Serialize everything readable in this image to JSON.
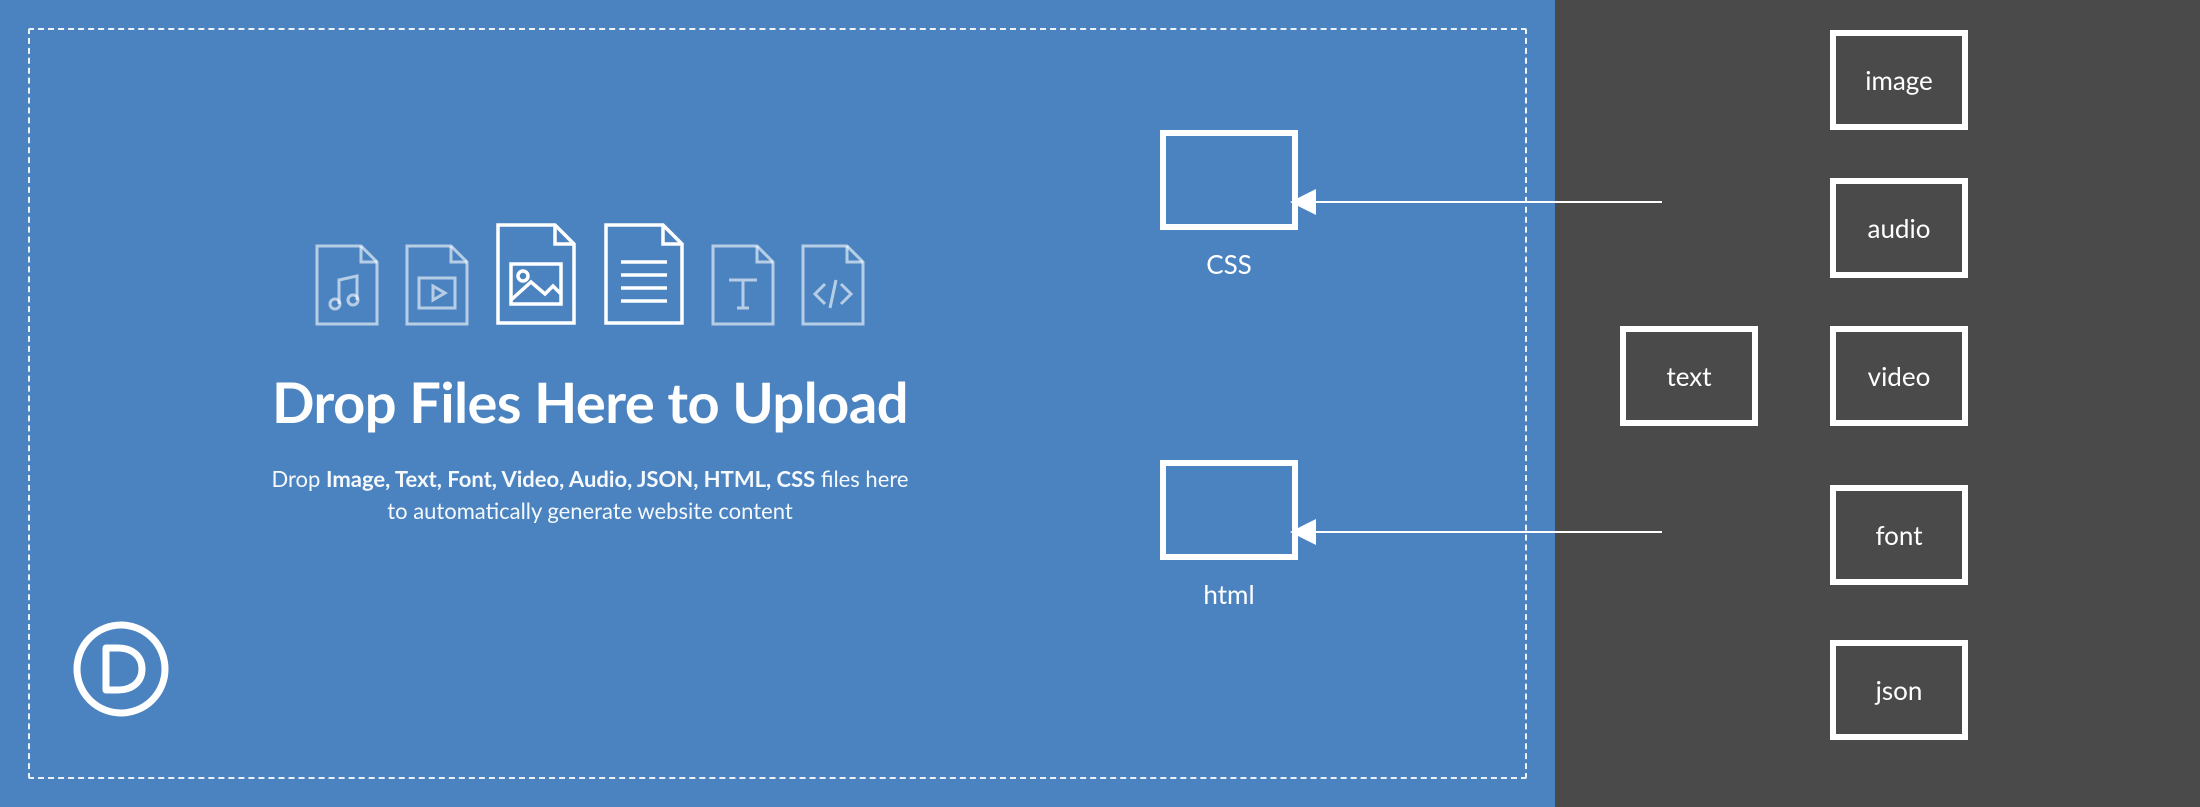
{
  "colors": {
    "blue": "#4a83c0",
    "gray": "#4a4a4a",
    "white": "#ffffff"
  },
  "dropzone": {
    "title": "Drop Files Here to Upload",
    "subtitle_prefix": "Drop ",
    "file_types_bold": "Image, Text, Font, Video, Audio, JSON, HTML, CSS",
    "subtitle_middle": " files here",
    "subtitle_line2": "to automatically generate website content",
    "icons": [
      "audio",
      "video",
      "image",
      "text",
      "font",
      "code"
    ]
  },
  "logo": {
    "letter": "D"
  },
  "drop_slots": [
    {
      "id": "css",
      "label": "CSS"
    },
    {
      "id": "html",
      "label": "html"
    }
  ],
  "source_tiles": [
    {
      "id": "image",
      "label": "image"
    },
    {
      "id": "audio",
      "label": "audio"
    },
    {
      "id": "text",
      "label": "text"
    },
    {
      "id": "video",
      "label": "video"
    },
    {
      "id": "font",
      "label": "font"
    },
    {
      "id": "json",
      "label": "json"
    }
  ]
}
